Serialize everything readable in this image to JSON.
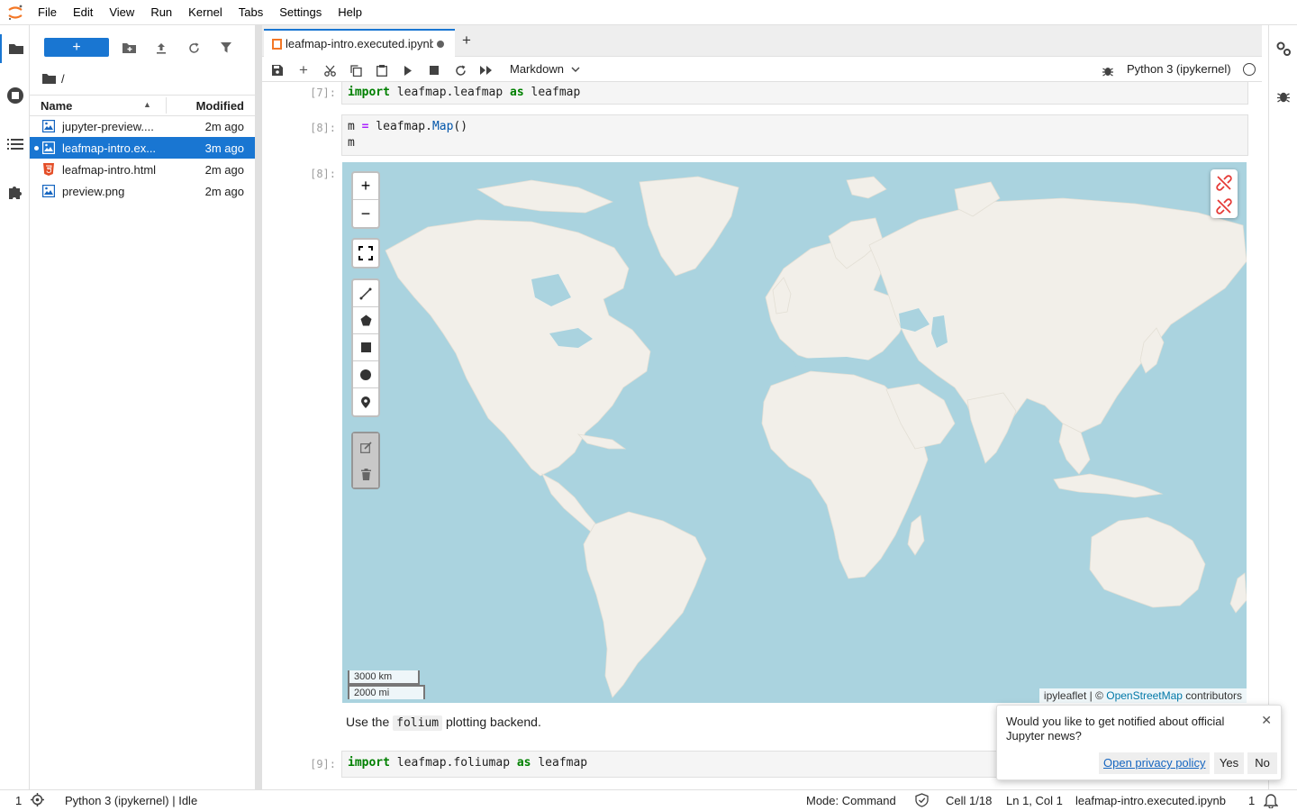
{
  "menu": [
    "File",
    "Edit",
    "View",
    "Run",
    "Kernel",
    "Tabs",
    "Settings",
    "Help"
  ],
  "file_browser": {
    "breadcrumb": "/",
    "columns": {
      "name": "Name",
      "modified": "Modified"
    },
    "files": [
      {
        "name": "jupyter-preview.png",
        "display": "jupyter-preview....",
        "modified": "2m ago",
        "type": "image"
      },
      {
        "name": "leafmap-intro.executed.ipynb",
        "display": "leafmap-intro.ex...",
        "modified": "3m ago",
        "type": "notebook"
      },
      {
        "name": "leafmap-intro.html",
        "display": "leafmap-intro.html",
        "modified": "2m ago",
        "type": "html"
      },
      {
        "name": "preview.png",
        "display": "preview.png",
        "modified": "2m ago",
        "type": "image"
      }
    ]
  },
  "tab": {
    "label": "leafmap-intro.executed.ipynb"
  },
  "toolbar": {
    "cell_type": "Markdown",
    "kernel": "Python 3 (ipykernel)"
  },
  "cells": {
    "c7": {
      "prompt": "[7]:"
    },
    "c8": {
      "prompt": "[8]:"
    },
    "out8": {
      "prompt": "[8]:"
    },
    "c9": {
      "prompt": "[9]:"
    }
  },
  "map": {
    "zoom_in": "+",
    "zoom_out": "−",
    "scale_km": "3000 km",
    "scale_mi": "2000 mi",
    "attribution_prefix": "ipyleaflet | © ",
    "attribution_link": "OpenStreetMap",
    "attribution_suffix": " contributors"
  },
  "markdown": {
    "before": "Use the ",
    "code": "folium",
    "after": " plotting backend."
  },
  "status": {
    "terminals": "1",
    "kernel": "Python 3 (ipykernel) | Idle",
    "mode": "Mode: Command",
    "cell": "Cell 1/18",
    "position": "Ln 1, Col 1",
    "filename": "leafmap-intro.executed.ipynb",
    "notifications": "1"
  },
  "notification": {
    "message": "Would you like to get notified about official Jupyter news?",
    "privacy": "Open privacy policy",
    "yes": "Yes",
    "no": "No"
  },
  "colors": {
    "accent": "#1976d2",
    "ocean": "#aad3df",
    "land": "#f2efe9"
  }
}
